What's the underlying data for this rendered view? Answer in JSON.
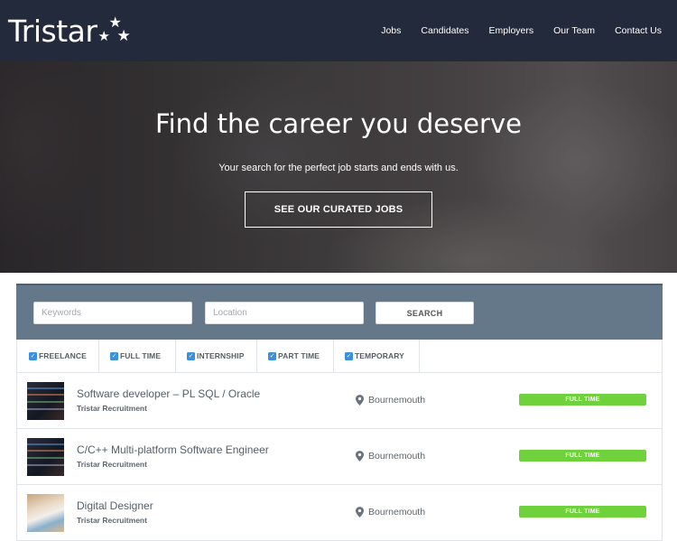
{
  "header": {
    "logo_text": "Tristar",
    "nav": [
      "Jobs",
      "Candidates",
      "Employers",
      "Our Team",
      "Contact Us"
    ]
  },
  "hero": {
    "title": "Find the career you deserve",
    "subtitle": "Your search for the perfect job starts and ends with us.",
    "cta_label": "SEE OUR CURATED JOBS"
  },
  "search": {
    "keywords_placeholder": "Keywords",
    "location_placeholder": "Location",
    "button_label": "SEARCH"
  },
  "filters": [
    {
      "label": "FREELANCE",
      "checked": true
    },
    {
      "label": "FULL TIME",
      "checked": true
    },
    {
      "label": "INTERNSHIP",
      "checked": true
    },
    {
      "label": "PART TIME",
      "checked": true
    },
    {
      "label": "TEMPORARY",
      "checked": true
    }
  ],
  "jobs": [
    {
      "title": "Software developer – PL SQL / Oracle",
      "company": "Tristar Recruitment",
      "location": "Bournemouth",
      "type": "FULL TIME",
      "thumb": "code"
    },
    {
      "title": "C/C++ Multi-platform Software Engineer",
      "company": "Tristar Recruitment",
      "location": "Bournemouth",
      "type": "FULL TIME",
      "thumb": "code"
    },
    {
      "title": "Digital Designer",
      "company": "Tristar Recruitment",
      "location": "Bournemouth",
      "type": "FULL TIME",
      "thumb": "design"
    }
  ],
  "colors": {
    "header_bg": "#232a3b",
    "search_panel_bg": "#65788a",
    "checkbox": "#3b8fe0",
    "badge_full_time": "#6fd13c"
  }
}
